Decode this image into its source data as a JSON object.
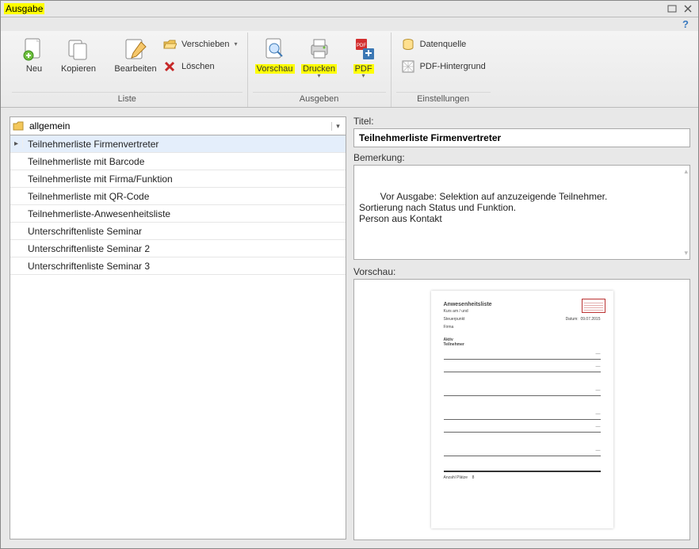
{
  "window": {
    "title": "Ausgabe"
  },
  "ribbon": {
    "liste": {
      "title": "Liste",
      "neu": "Neu",
      "kopieren": "Kopieren",
      "bearbeiten": "Bearbeiten",
      "verschieben": "Verschieben",
      "loeschen": "Löschen"
    },
    "ausgeben": {
      "title": "Ausgeben",
      "vorschau": "Vorschau",
      "drucken": "Drucken",
      "pdf": "PDF"
    },
    "einstellungen": {
      "title": "Einstellungen",
      "datenquelle": "Datenquelle",
      "pdf_hintergrund": "PDF-Hintergrund"
    }
  },
  "left": {
    "combo": "allgemein",
    "items": [
      "Teilnehmerliste Firmenvertreter",
      "Teilnehmerliste mit Barcode",
      "Teilnehmerliste mit Firma/Funktion",
      "Teilnehmerliste mit QR-Code",
      "Teilnehmerliste-Anwesenheitsliste",
      "Unterschriftenliste Seminar",
      "Unterschriftenliste Seminar 2",
      "Unterschriftenliste Seminar 3"
    ]
  },
  "right": {
    "titel_label": "Titel:",
    "titel_value": "Teilnehmerliste Firmenvertreter",
    "bemerkung_label": "Bemerkung:",
    "bemerkung_value": "Vor Ausgabe: Selektion auf anzuzeigende Teilnehmer.\nSortierung nach Status und Funktion.\nPerson aus Kontakt",
    "vorschau_label": "Vorschau:"
  },
  "preview": {
    "heading": "Anwesenheitsliste",
    "row1_l": "Kurs am / und",
    "row2_l": "Steuerpunkt",
    "row2_c": "Datum:",
    "row2_r": "09.07.2015",
    "row3_l": "Firma",
    "sect": "Teilnehmer"
  }
}
